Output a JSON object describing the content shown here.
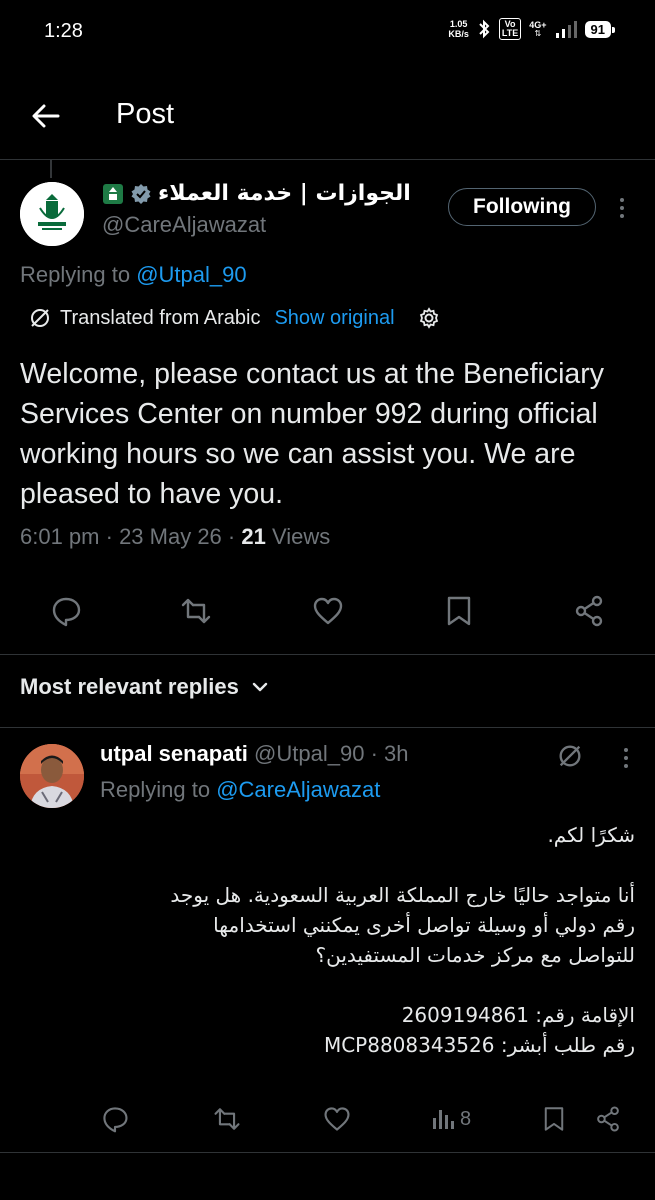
{
  "status_bar": {
    "time": "1:28",
    "net_speed_value": "1.05",
    "net_speed_unit": "KB/s",
    "volte_top": "Vo",
    "volte_bottom": "LTE",
    "network": "4G+",
    "battery": "91"
  },
  "header": {
    "title": "Post"
  },
  "post": {
    "author_name": "الجوازات | خدمة العملاء",
    "author_handle": "@CareAljawazat",
    "follow_label": "Following",
    "replying_prefix": "Replying to ",
    "replying_to": "@Utpal_90",
    "translated_label": "Translated from Arabic",
    "show_original_label": "Show original",
    "text": "Welcome, please contact us at the Beneficiary Services Center on number 992 during official working hours so we can assist you. We are pleased to have you.",
    "time": "6:01 pm",
    "date": "23 May 26",
    "views_count": "21",
    "views_label": "Views",
    "sep": " · "
  },
  "replies_filter": {
    "label": "Most relevant replies"
  },
  "reply": {
    "name": "utpal senapati",
    "handle": "@Utpal_90",
    "age": "3h",
    "replying_prefix": "Replying to ",
    "replying_to": "@CareAljawazat",
    "line1": "شكرًا لكم.",
    "line2": "أنا متواجد حاليًا خارج المملكة العربية السعودية. هل يوجد",
    "line3": "رقم دولي أو وسيلة تواصل أخرى يمكنني استخدامها",
    "line4": "للتواصل مع مركز خدمات المستفيدين؟",
    "line5": "الإقامة رقم: 2609194861",
    "line6": "رقم طلب أبشر: MCP8808343526",
    "views": "8"
  },
  "colors": {
    "background": "#000000",
    "text": "#e7e9ea",
    "muted": "#71767b",
    "link": "#1d9bf0",
    "divider": "#2f3336"
  }
}
